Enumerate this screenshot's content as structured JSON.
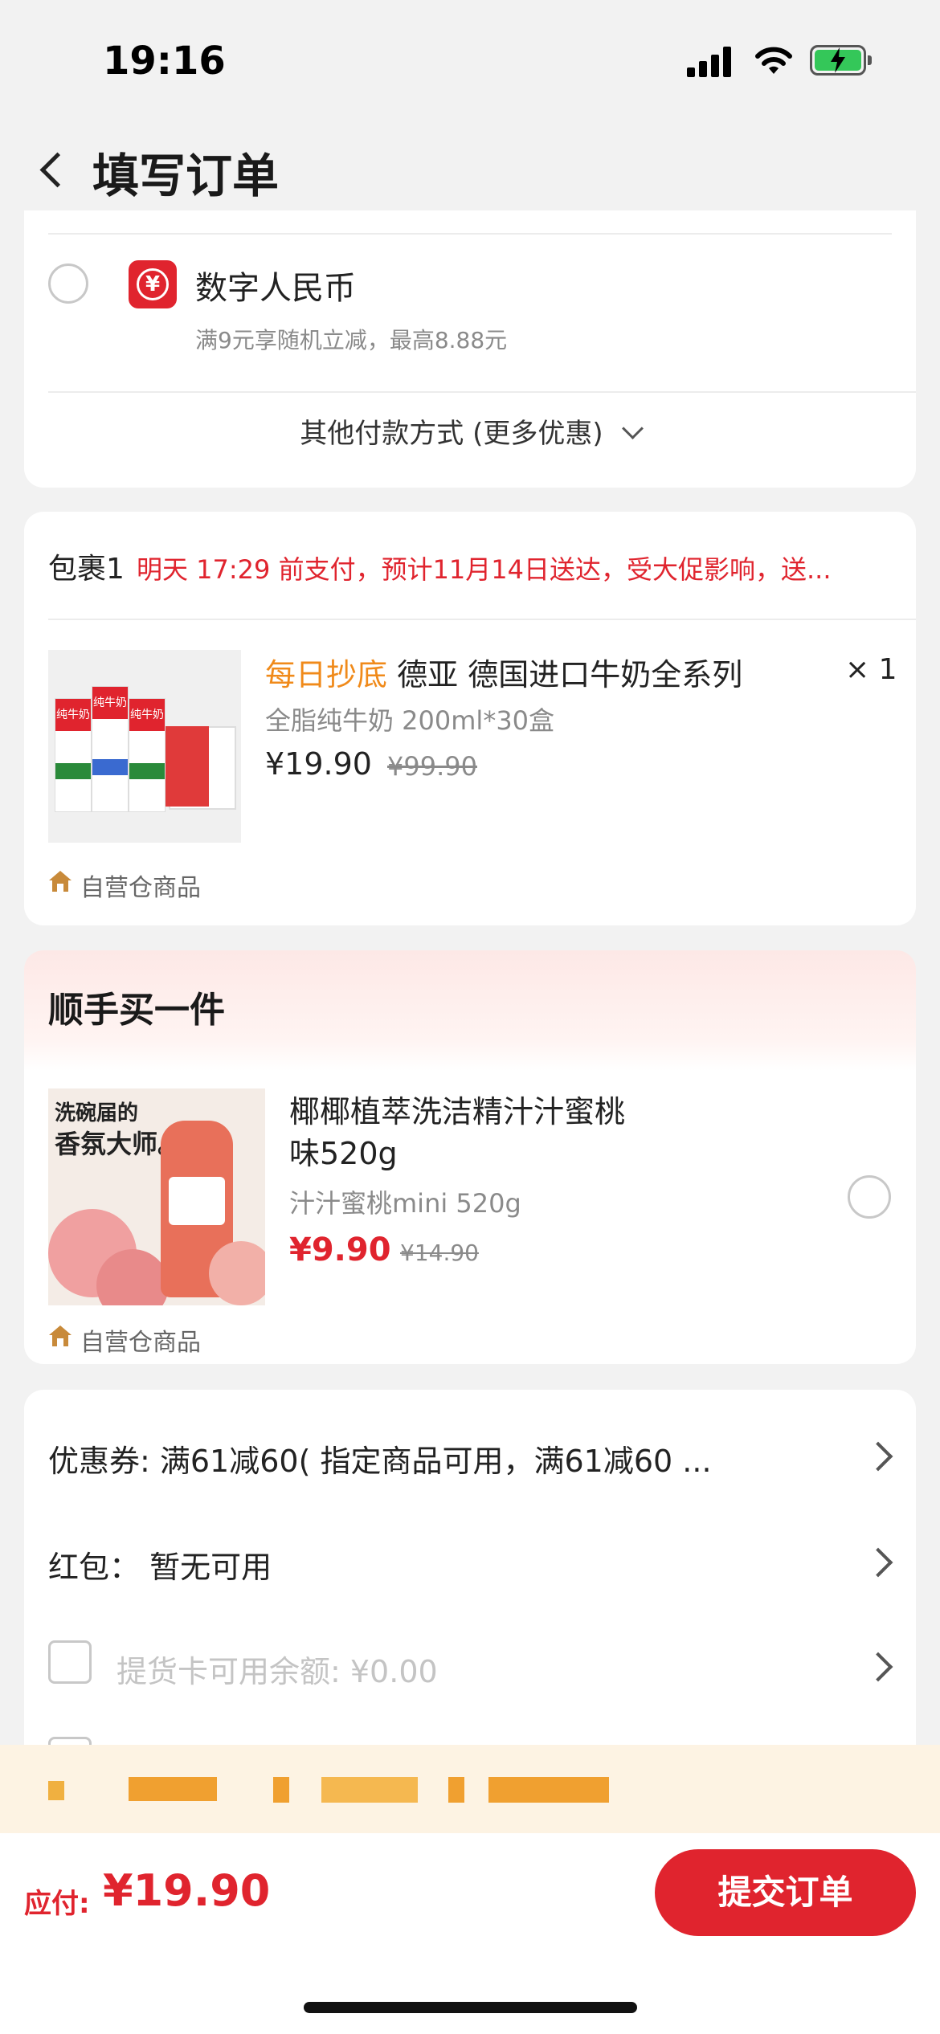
{
  "status_bar": {
    "time": "19:16"
  },
  "header": {
    "title": "填写订单"
  },
  "payment": {
    "digital_rmb_label": "数字人民币",
    "digital_rmb_desc": "满9元享随机立减，最高8.88元",
    "other_methods": "其他付款方式 (更多优惠)"
  },
  "package": {
    "label": "包裹1",
    "notice": "明天 17:29 前支付，预计11月14日送达，受大促影响，送...",
    "product": {
      "tag": "每日抄底",
      "title": "德亚 德国进口牛奶全系列",
      "spec": "全脂纯牛奶 200ml*30盒",
      "price": "¥19.90",
      "original_price": "¥99.90",
      "quantity": "× 1",
      "badge": "自营仓商品",
      "image_text": [
        "纯牛奶",
        "纯牛奶",
        "纯牛奶"
      ]
    }
  },
  "addon": {
    "title": "顺手买一件",
    "product": {
      "title_line1": "椰椰植萃洗洁精汁汁蜜桃",
      "title_line2": "味520g",
      "spec": "汁汁蜜桃mini 520g",
      "price": "¥9.90",
      "original_price": "¥14.90",
      "badge": "自营仓商品",
      "image_caption_1": "洗碗届的",
      "image_caption_2": "香氛大师。"
    }
  },
  "discounts": {
    "coupon": "优惠券: 满61减60( 指定商品可用，满61减60 ...",
    "red_packet": "红包：  暂无可用",
    "pickup_card": "提货卡可用余额: ¥0.00"
  },
  "footer": {
    "pay_label": "应付:",
    "pay_amount": "¥19.90",
    "submit": "提交订单"
  },
  "colors": {
    "accent": "#e0242e",
    "tag": "#f08a1a"
  }
}
